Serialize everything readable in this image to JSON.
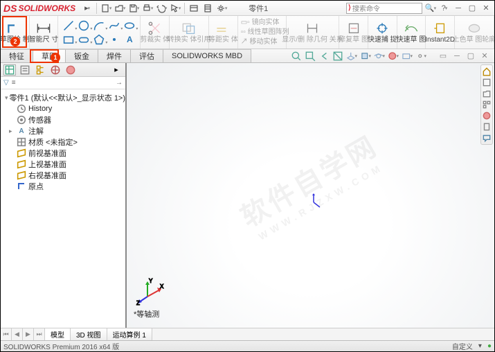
{
  "app": {
    "name": "SOLIDWORKS",
    "doc_title": "零件1"
  },
  "search": {
    "placeholder": "搜索命令"
  },
  "ribbon": {
    "sketch_draw": "草图绘\n制",
    "smart_dim": "智能尺\n寸",
    "trim": "剪裁实\n体",
    "convert": "转换实\n体引用",
    "offset": "等距实\n体",
    "mirror": "镜向实体",
    "linear_pattern": "线性草图阵列",
    "move": "移动实体",
    "show_del": "显示/删\n除几何\n关系",
    "repair": "修复草\n图",
    "quick_snap": "快速捕\n捉",
    "rapid": "快速草\n图",
    "instant2d": "Instant2D",
    "shaded": "上色草\n图轮廓"
  },
  "cmdtabs": [
    "特征",
    "草图",
    "钣金",
    "焊件",
    "评估",
    "SOLIDWORKS MBD"
  ],
  "tree": {
    "root": "零件1 (默认<<默认>_显示状态 1>)",
    "items": [
      {
        "icon": "history",
        "label": "History"
      },
      {
        "icon": "sensor",
        "label": "传感器"
      },
      {
        "icon": "annot",
        "label": "注解"
      },
      {
        "icon": "material",
        "label": "材质 <未指定>"
      },
      {
        "icon": "plane",
        "label": "前视基准面"
      },
      {
        "icon": "plane",
        "label": "上视基准面"
      },
      {
        "icon": "plane",
        "label": "右视基准面"
      },
      {
        "icon": "origin",
        "label": "原点"
      }
    ]
  },
  "view": {
    "label": "*等轴测"
  },
  "bottom_tabs": [
    "模型",
    "3D 视图",
    "运动算例 1"
  ],
  "status": {
    "left": "SOLIDWORKS Premium 2016 x64 版",
    "custom": "自定义"
  },
  "badges": {
    "sketch_ribbon": "2",
    "sketch_tab": "1"
  },
  "watermark": {
    "main": "软件自学网",
    "sub": "WWW.RJZXW.COM"
  }
}
